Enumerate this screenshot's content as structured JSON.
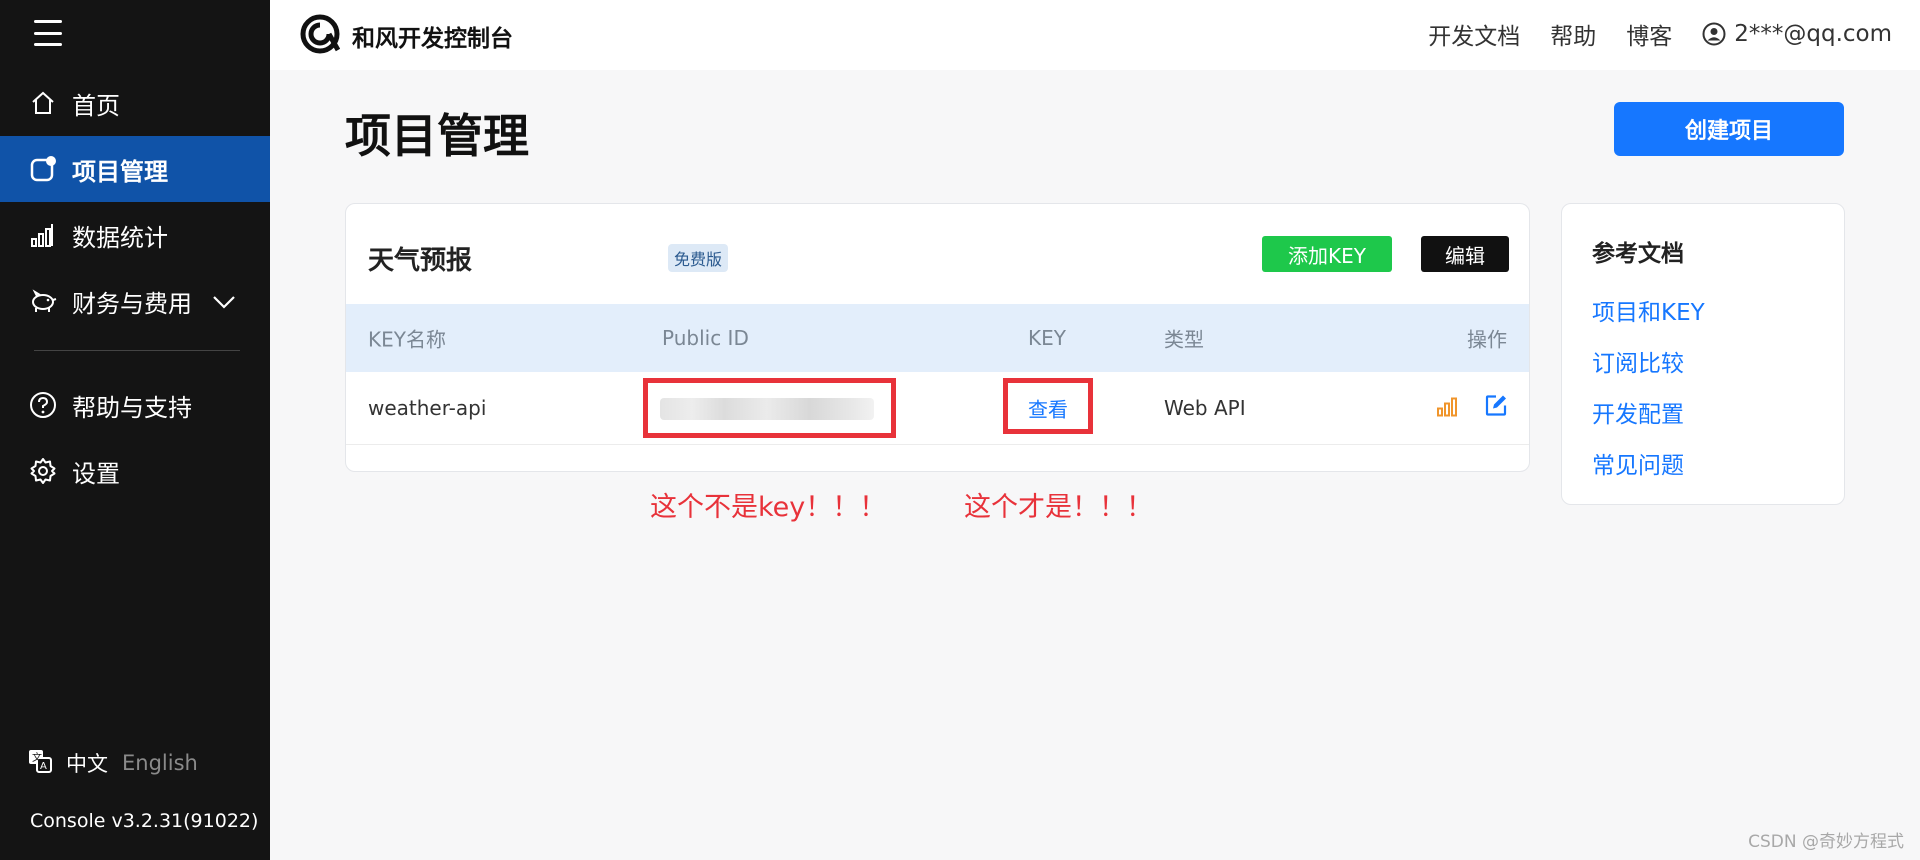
{
  "sidebar": {
    "items": [
      {
        "label": "首页",
        "icon": "home-icon"
      },
      {
        "label": "项目管理",
        "icon": "project-icon",
        "active": true
      },
      {
        "label": "数据统计",
        "icon": "bar-chart-icon"
      },
      {
        "label": "财务与费用",
        "icon": "piggy-bank-icon"
      },
      {
        "label": "帮助与支持",
        "icon": "question-circle-icon"
      },
      {
        "label": "设置",
        "icon": "gear-icon"
      }
    ],
    "lang_zh": "中文",
    "lang_en": "English",
    "version": "Console v3.2.31(91022)"
  },
  "header": {
    "brand": "和风开发控制台",
    "links": [
      "开发文档",
      "帮助",
      "博客"
    ],
    "user": "2***@qq.com"
  },
  "main": {
    "title": "项目管理",
    "create_button": "创建项目",
    "project": {
      "name": "天气预报",
      "badge": "免费版",
      "add_key_button": "添加KEY",
      "edit_button": "编辑",
      "columns": [
        "KEY名称",
        "Public ID",
        "KEY",
        "类型",
        "操作"
      ],
      "row": {
        "key_name": "weather-api",
        "key_link": "查看",
        "type": "Web API"
      }
    },
    "annotations": {
      "not_key": "这个不是key！！！",
      "is_key": "这个才是！！！"
    }
  },
  "reference": {
    "title": "参考文档",
    "links": [
      "项目和KEY",
      "订阅比较",
      "开发配置",
      "常见问题"
    ]
  },
  "watermark": "CSDN @奇妙方程式",
  "colors": {
    "accent": "#1677ff",
    "sidebar_bg": "#141414",
    "sidebar_active": "#1053a8",
    "green": "#1ec84b",
    "annotation_red": "#e8323a"
  }
}
